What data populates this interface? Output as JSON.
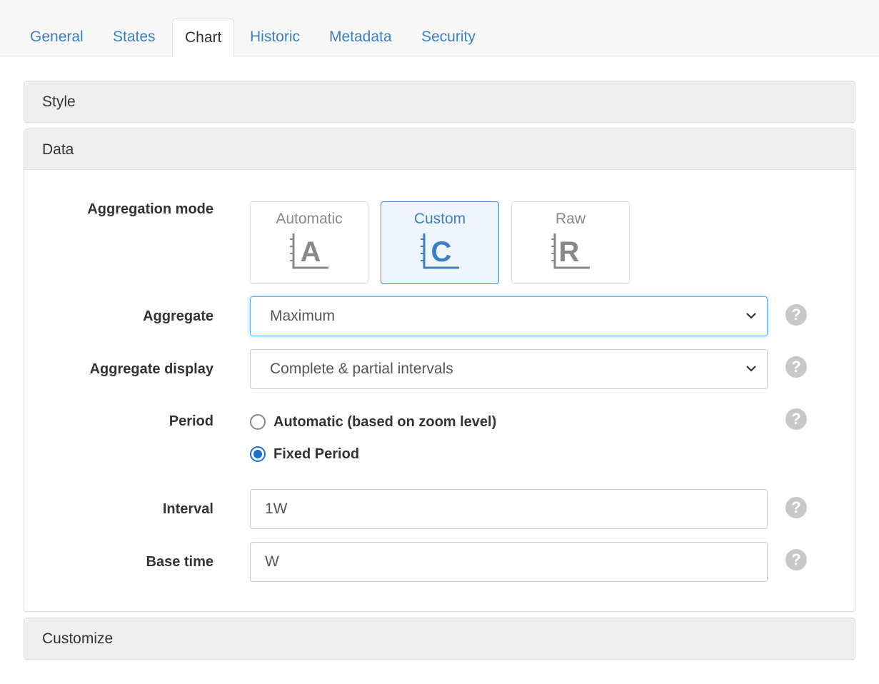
{
  "tabs": [
    {
      "label": "General"
    },
    {
      "label": "States"
    },
    {
      "label": "Chart"
    },
    {
      "label": "Historic"
    },
    {
      "label": "Metadata"
    },
    {
      "label": "Security"
    }
  ],
  "active_tab": "Chart",
  "panels": {
    "style": {
      "title": "Style"
    },
    "data": {
      "title": "Data"
    },
    "customize": {
      "title": "Customize"
    }
  },
  "form": {
    "aggregation_mode": {
      "label": "Aggregation mode",
      "options": [
        {
          "label": "Automatic",
          "letter": "A"
        },
        {
          "label": "Custom",
          "letter": "C"
        },
        {
          "label": "Raw",
          "letter": "R"
        }
      ],
      "selected": "Custom"
    },
    "aggregate": {
      "label": "Aggregate",
      "value": "Maximum"
    },
    "aggregate_display": {
      "label": "Aggregate display",
      "value": "Complete & partial intervals"
    },
    "period": {
      "label": "Period",
      "options": [
        {
          "label": "Automatic (based on zoom level)",
          "checked": false
        },
        {
          "label": "Fixed Period",
          "checked": true
        }
      ]
    },
    "interval": {
      "label": "Interval",
      "value": "1W"
    },
    "base_time": {
      "label": "Base time",
      "value": "W"
    }
  },
  "help_icon_glyph": "?",
  "colors": {
    "accent": "#3b7fc4",
    "selected_border": "#4a86c2",
    "radio_checked": "#1f6fd1",
    "help_icon": "#c8c8c8",
    "panel_heading_bg": "#efefef"
  }
}
